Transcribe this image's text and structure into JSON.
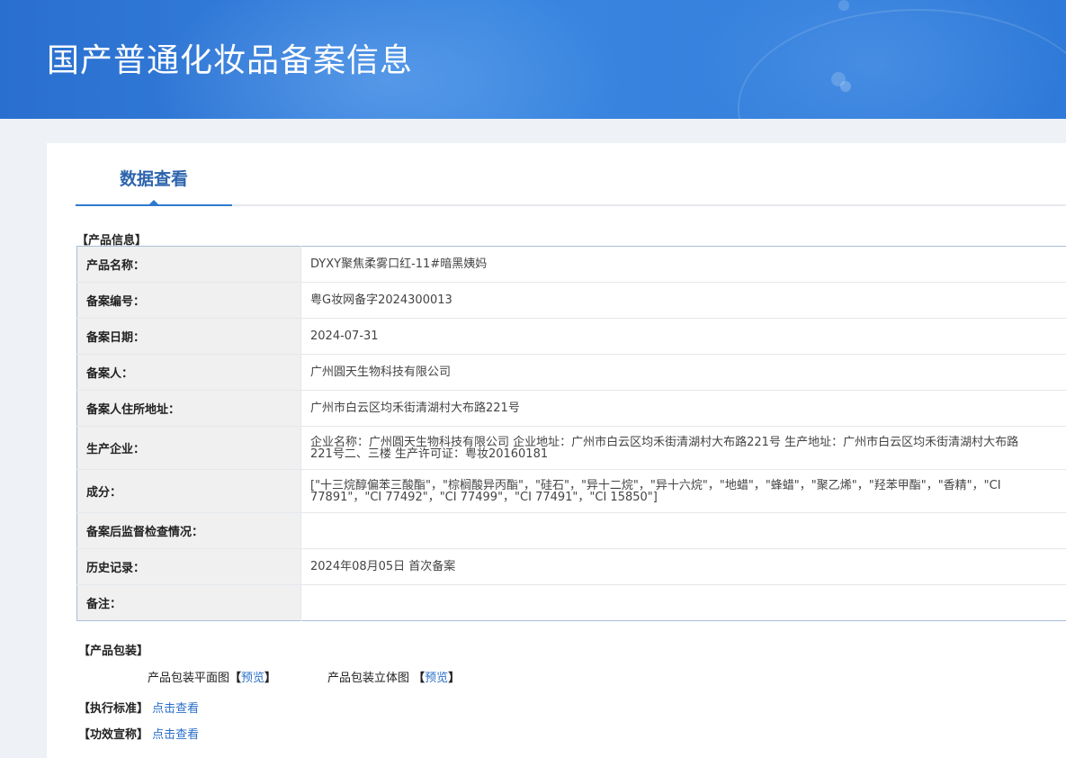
{
  "header": {
    "title": "国产普通化妆品备案信息"
  },
  "tabs": [
    {
      "label": "数据查看"
    }
  ],
  "product_info": {
    "section_title": "【产品信息】",
    "rows": [
      {
        "label": "产品名称：",
        "value": "DYXY聚焦柔雾口红-11#暗黑姨妈"
      },
      {
        "label": "备案编号：",
        "value": "粤G妆网备字2024300013"
      },
      {
        "label": "备案日期：",
        "value": "2024-07-31"
      },
      {
        "label": "备案人：",
        "value": "广州圓天生物科技有限公司"
      },
      {
        "label": "备案人住所地址：",
        "value": "广州市白云区均禾街清湖村大布路221号"
      },
      {
        "label": "生产企业：",
        "value": "企业名称：广州圓天生物科技有限公司 企业地址：广州市白云区均禾街清湖村大布路221号 生产地址：广州市白云区均禾街清湖村大布路221号二、三楼 生产许可证：粤妆20160181"
      },
      {
        "label": "成分：",
        "value": "[\"十三烷醇偏苯三酸酯\"，\"棕榈酸异丙酯\"，\"硅石\"，\"异十二烷\"，\"异十六烷\"，\"地蜡\"，\"蜂蜡\"，\"聚乙烯\"，\"羟苯甲酯\"，\"香精\"，\"CI 77891\"，\"CI 77492\"，\"CI 77499\"，\"CI 77491\"，\"CI 15850\"]"
      },
      {
        "label": "备案后监督检查情况：",
        "value": ""
      },
      {
        "label": "历史记录：",
        "value": "2024年08月05日 首次备案"
      },
      {
        "label": "备注：",
        "value": ""
      }
    ]
  },
  "packaging": {
    "section_title": "【产品包装】",
    "flat_label": "产品包装平面图",
    "flat_preview": "预览",
    "stereo_label": "产品包装立体图",
    "stereo_preview": "预览",
    "bracket_open": "【",
    "bracket_close": "】"
  },
  "standard": {
    "label": "【执行标准】",
    "link": "点击查看"
  },
  "efficacy": {
    "label": "【功效宣称】",
    "link": "点击查看"
  },
  "colors": {
    "banner": "#3a86e0",
    "tab_active": "#2d64ad",
    "link": "#2a6fc9",
    "table_border": "#a9bedb",
    "label_bg": "#f0f0f0"
  }
}
